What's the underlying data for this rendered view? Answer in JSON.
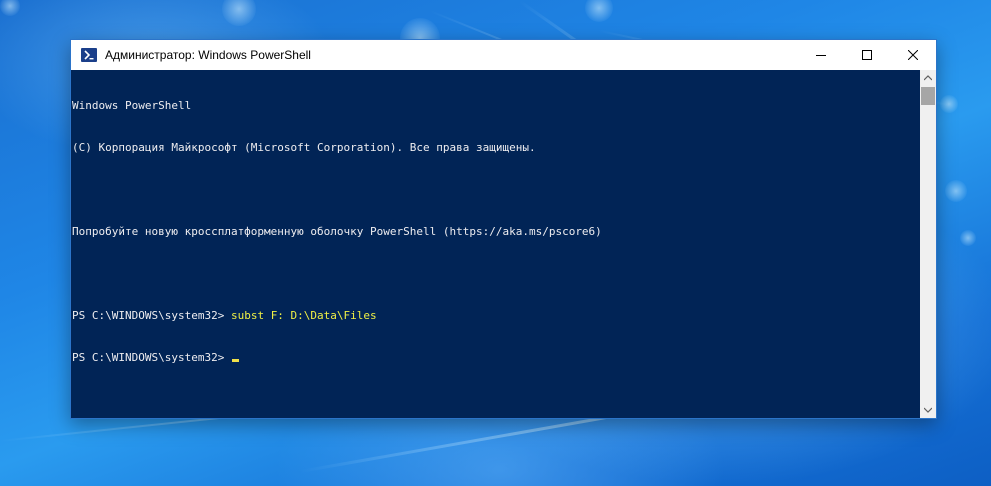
{
  "window": {
    "title": "Администратор: Windows PowerShell",
    "icon": "powershell-icon"
  },
  "console": {
    "lines": [
      "Windows PowerShell",
      "(C) Корпорация Майкрософт (Microsoft Corporation). Все права защищены.",
      "",
      "Попробуйте новую кроссплатформенную оболочку PowerShell (https://aka.ms/pscore6)",
      ""
    ],
    "prompt": "PS C:\\WINDOWS\\system32> ",
    "command": "subst F: D:\\Data\\Files",
    "current_prompt": "PS C:\\WINDOWS\\system32> "
  },
  "colors": {
    "console_background": "#012456",
    "console_text": "#eeedf0",
    "command_text": "#f0f045"
  }
}
